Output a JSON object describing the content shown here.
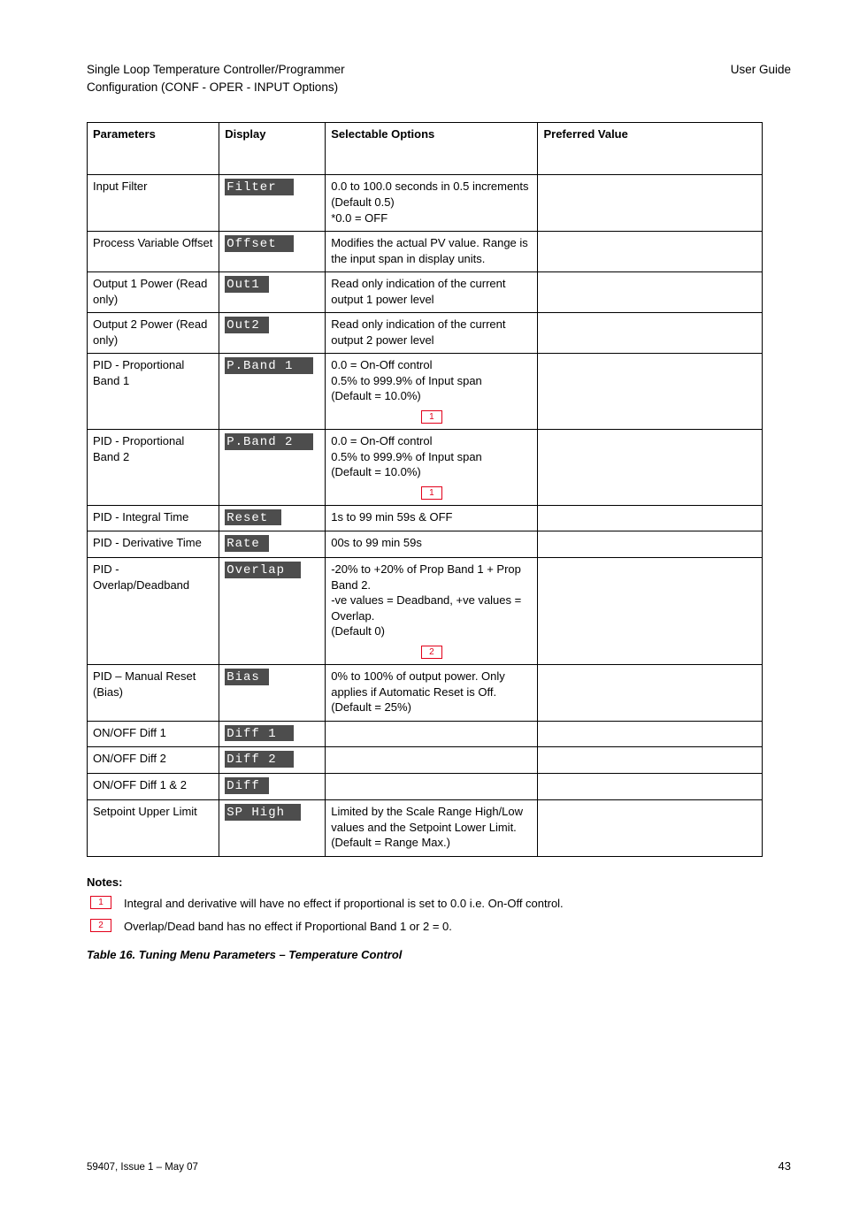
{
  "header": {
    "line1_left": "Single Loop Temperature Controller/Programmer",
    "line1_right": "User Guide",
    "line2": "Configuration (CONF - OPER - INPUT Options)"
  },
  "columns": {
    "c0": "Parameters",
    "c1": "Display",
    "c2": "Selectable Options",
    "c3": "Preferred Value"
  },
  "rows": [
    {
      "param": "Input Filter",
      "label": "Filter",
      "label_width": 76,
      "option": "0.0 to 100.0 seconds in 0.5 increments\n(Default 0.5)\n*0.0 = OFF",
      "preferred": "",
      "note": null
    },
    {
      "param": "Process Variable Offset",
      "label": "Offset",
      "label_width": 76,
      "option": "Modifies the actual PV value. Range is the input span in display units.",
      "preferred": "",
      "note": null
    },
    {
      "param": "Output 1 Power (Read only)",
      "label": "Out1",
      "label_width": 48,
      "option": "Read only indication of the current output 1 power level",
      "preferred": "",
      "note": null
    },
    {
      "param": "Output 2 Power (Read only)",
      "label": "Out2",
      "label_width": 48,
      "option": "Read only indication of the current output 2 power level",
      "preferred": "",
      "note": null
    },
    {
      "param": "PID - Proportional Band 1",
      "label": "P.Band 1",
      "label_width": 98,
      "option": "0.0 = On-Off control\n0.5% to 999.9% of Input span\n(Default = 10.0%)",
      "preferred": "",
      "note": "1"
    },
    {
      "param": "PID - Proportional Band 2",
      "label": "P.Band 2",
      "label_width": 98,
      "option": "0.0 = On-Off control\n0.5% to 999.9% of Input span\n(Default = 10.0%)",
      "preferred": "",
      "note": "1"
    },
    {
      "param": "PID - Integral Time",
      "label": "Reset",
      "label_width": 62,
      "option": "1s to 99 min 59s & OFF",
      "preferred": "",
      "note": null
    },
    {
      "param": "PID - Derivative Time",
      "label": "Rate",
      "label_width": 48,
      "option": "00s to 99 min 59s",
      "preferred": "",
      "note": null
    },
    {
      "param": "PID - Overlap/Deadband",
      "label": "Overlap",
      "label_width": 84,
      "option": "-20% to +20% of Prop Band 1 + Prop Band 2.\n-ve values = Deadband, +ve values = Overlap.\n(Default 0)",
      "preferred": "",
      "note": "2"
    },
    {
      "param": "PID – Manual Reset (Bias)",
      "label": "Bias",
      "label_width": 48,
      "option": "0% to 100% of output power. Only applies if Automatic Reset is Off.\n(Default = 25%)",
      "preferred": "",
      "note": null
    },
    {
      "param": "ON/OFF Diff 1",
      "label": "Diff 1",
      "label_width": 76,
      "option": "",
      "preferred": "",
      "note": null
    },
    {
      "param": "ON/OFF Diff 2",
      "label": "Diff 2",
      "label_width": 76,
      "option": "",
      "preferred": "",
      "note": null
    },
    {
      "param": "ON/OFF Diff 1 & 2",
      "label": "Diff",
      "label_width": 48,
      "option": "",
      "preferred": "",
      "note": null
    },
    {
      "param": "Setpoint Upper Limit",
      "label": "SP High",
      "label_width": 84,
      "option": "Limited by the Scale Range High/Low values and the Setpoint Lower Limit.\n(Default = Range Max.)",
      "preferred": "",
      "note": null
    }
  ],
  "trailer": {
    "notes_heading": "Notes:",
    "notes": [
      {
        "ref": "1",
        "text": "Integral and derivative will have no effect if proportional is set to 0.0 i.e. On-Off control."
      },
      {
        "ref": "2",
        "text": "Overlap/Dead band has no effect if Proportional Band 1 or 2 = 0."
      }
    ],
    "table_title": "Table 16.  Tuning Menu Parameters – Temperature Control"
  },
  "footer": {
    "doc": "59407, Issue 1 – May 07",
    "page": "43"
  }
}
